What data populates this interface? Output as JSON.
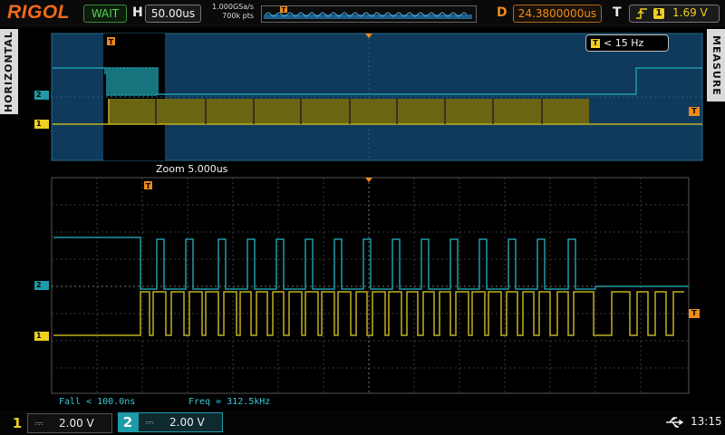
{
  "header": {
    "brand": "RIGOL",
    "run_state": "WAIT",
    "horizontal_label": "H",
    "timebase": "50.00us",
    "sample_rate": "1.000GSa/s",
    "memory_depth": "700k pts",
    "delay_label": "D",
    "delay_value": "24.3800000us",
    "trigger_label": "T",
    "trigger_source": "1",
    "trigger_level": "1.69 V"
  },
  "side_tabs": {
    "left": "HORIZONTAL",
    "right": "MEASURE"
  },
  "overview": {
    "trigger_freq": "< 15 Hz"
  },
  "zoom": {
    "label": "Zoom  5.000us"
  },
  "measurements": {
    "fall": "Fall < 100.0ns",
    "freq": "Freq = 312.5kHz"
  },
  "channels": [
    {
      "number": "1",
      "scale": "2.00 V",
      "color": "#f0d020"
    },
    {
      "number": "2",
      "scale": "2.00 V",
      "color": "#1e9aa8"
    }
  ],
  "status": {
    "clock": "13:15"
  },
  "markers": {
    "ch1": "1",
    "ch2": "2",
    "trigger": "T"
  },
  "colors": {
    "brand": "#f06a1a",
    "ch1": "#c0b020",
    "ch2": "#1e9aa8",
    "delay": "#f08a1a"
  }
}
